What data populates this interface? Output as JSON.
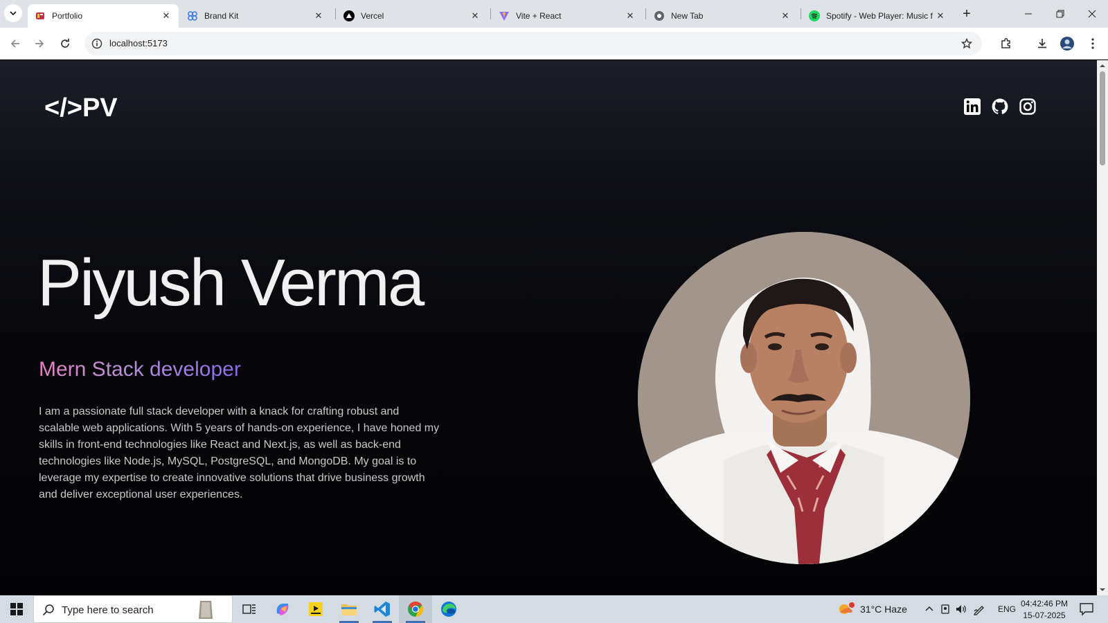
{
  "browser": {
    "tabs": [
      {
        "title": "Portfolio",
        "icon": "portfolio-favicon",
        "active": true
      },
      {
        "title": "Brand Kit",
        "icon": "brandkit-favicon",
        "active": false
      },
      {
        "title": "Vercel",
        "icon": "vercel-favicon",
        "active": false
      },
      {
        "title": "Vite + React",
        "icon": "vite-favicon",
        "active": false
      },
      {
        "title": "New Tab",
        "icon": "chrome-favicon",
        "active": false
      },
      {
        "title": "Spotify - Web Player: Music f",
        "icon": "spotify-favicon",
        "active": false
      }
    ],
    "close_glyph": "✕",
    "new_tab_glyph": "+",
    "url": "localhost:5173"
  },
  "page": {
    "logo_text": "</>PV",
    "name": "Piyush Verma",
    "role": "Mern Stack developer",
    "bio": "I am a passionate full stack developer with a knack for crafting robust and scalable web applications. With 5 years of hands-on experience, I have honed my skills in front-end technologies like React and Next.js, as well as back-end technologies like Node.js, MySQL, PostgreSQL, and MongoDB. My goal is to leverage my expertise to create innovative solutions that drive business growth and deliver exceptional user experiences.",
    "social_icons": [
      "linkedin-icon",
      "github-icon",
      "instagram-icon"
    ],
    "colors": {
      "role_gradient_start": "#ec80c8",
      "role_gradient_end": "#8a6be8",
      "portrait_bg": "#a2958b"
    }
  },
  "taskbar": {
    "search_placeholder": "Type here to search",
    "weather": "31°C  Haze",
    "language": "ENG",
    "time": "04:42:46 PM",
    "date": "15-07-2025"
  }
}
